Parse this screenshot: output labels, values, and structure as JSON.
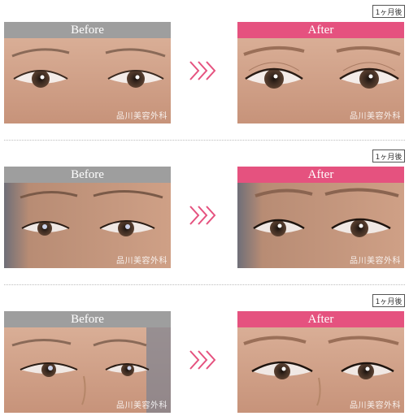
{
  "labels": {
    "before": "Before",
    "after": "After",
    "watermark": "品川美容外科"
  },
  "cases": [
    {
      "badge": "1ヶ月後"
    },
    {
      "badge": "1ヶ月後"
    },
    {
      "badge": "1ヶ月後"
    }
  ],
  "colors": {
    "before_bar": "#9e9e9e",
    "after_bar": "#e5527f",
    "arrow": "#e5527f"
  },
  "icons": {
    "arrow": "triple-chevron-right-icon"
  }
}
